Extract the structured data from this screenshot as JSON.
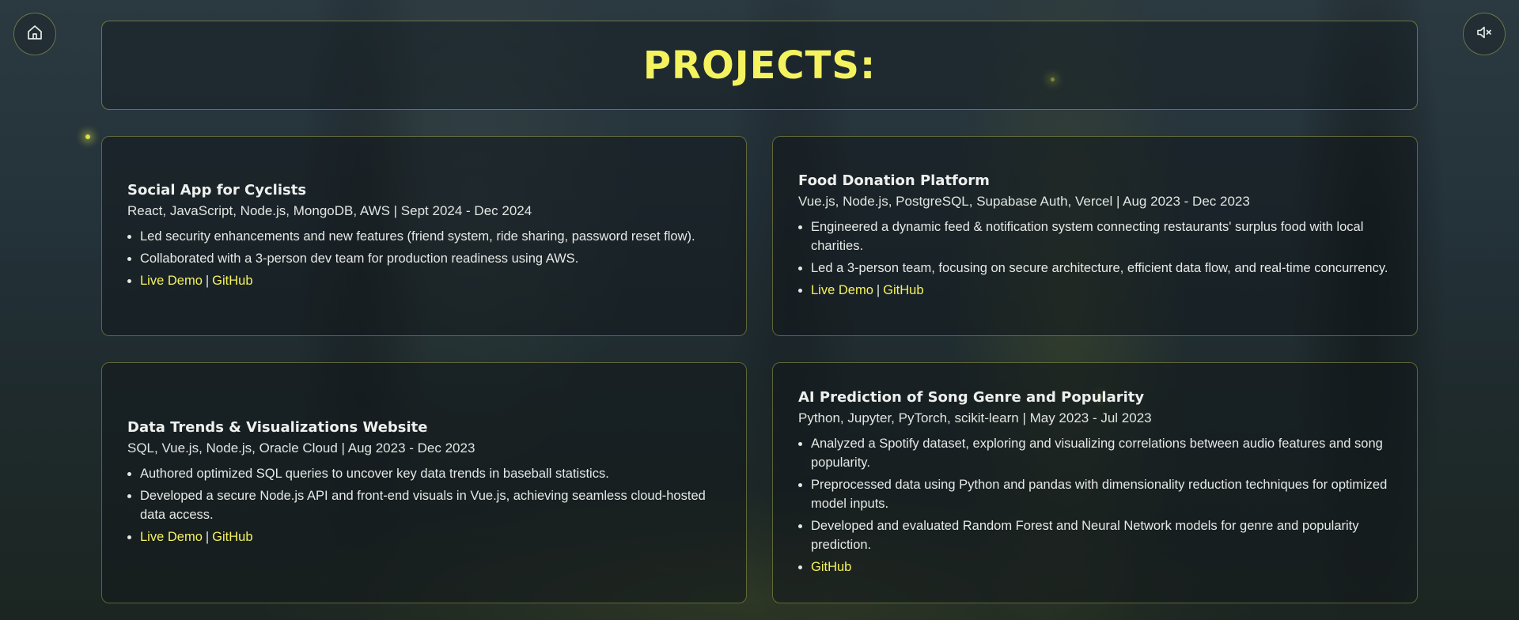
{
  "header": {
    "title": "PROJECTS:"
  },
  "nav": {
    "home_icon": "home-icon",
    "sound_icon": "sound-muted-icon"
  },
  "accent_color": "#f4f25e",
  "projects": [
    {
      "title": "Social App for Cyclists",
      "tech": "React, JavaScript, Node.js, MongoDB, AWS | Sept 2024 - Dec 2024",
      "bullets": [
        "Led security enhancements and new features (friend system, ride sharing, password reset flow).",
        "Collaborated with a 3-person dev team for production readiness using AWS."
      ],
      "live_demo": "Live Demo",
      "separator": "|",
      "github": "GitHub"
    },
    {
      "title": "Food Donation Platform",
      "tech": "Vue.js, Node.js, PostgreSQL, Supabase Auth, Vercel | Aug 2023 - Dec 2023",
      "bullets": [
        "Engineered a dynamic feed & notification system connecting restaurants' surplus food with local charities.",
        "Led a 3-person team, focusing on secure architecture, efficient data flow, and real-time concurrency."
      ],
      "live_demo": "Live Demo",
      "separator": "|",
      "github": "GitHub"
    },
    {
      "title": "Data Trends & Visualizations Website",
      "tech": "SQL, Vue.js, Node.js, Oracle Cloud | Aug 2023 - Dec 2023",
      "bullets": [
        "Authored optimized SQL queries to uncover key data trends in baseball statistics.",
        "Developed a secure Node.js API and front-end visuals in Vue.js, achieving seamless cloud-hosted data access."
      ],
      "live_demo": "Live Demo",
      "separator": "|",
      "github": "GitHub"
    },
    {
      "title": "AI Prediction of Song Genre and Popularity",
      "tech": "Python, Jupyter, PyTorch, scikit-learn | May 2023 - Jul 2023",
      "bullets": [
        "Analyzed a Spotify dataset, exploring and visualizing correlations between audio features and song popularity.",
        "Preprocessed data using Python and pandas with dimensionality reduction techniques for optimized model inputs.",
        "Developed and evaluated Random Forest and Neural Network models for genre and popularity prediction."
      ],
      "github": "GitHub"
    }
  ]
}
